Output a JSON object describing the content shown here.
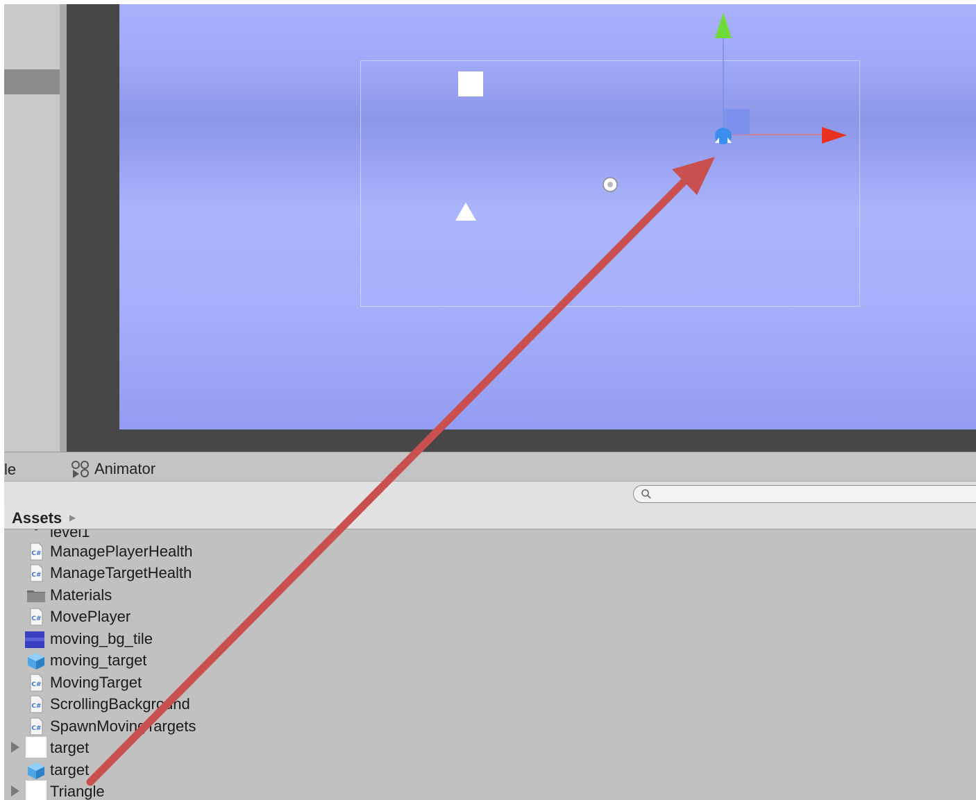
{
  "tabs": {
    "partial_label": "le",
    "animator_label": "Animator"
  },
  "search": {
    "placeholder": ""
  },
  "breadcrumb": {
    "root": "Assets"
  },
  "assets": [
    {
      "label": "level1",
      "icon": "scene-icon",
      "foldable": false
    },
    {
      "label": "ManagePlayerHealth",
      "icon": "csharp-script-icon",
      "foldable": false
    },
    {
      "label": "ManageTargetHealth",
      "icon": "csharp-script-icon",
      "foldable": false
    },
    {
      "label": "Materials",
      "icon": "folder-icon",
      "foldable": false
    },
    {
      "label": "MovePlayer",
      "icon": "csharp-script-icon",
      "foldable": false
    },
    {
      "label": "moving_bg_tile",
      "icon": "texture-icon",
      "foldable": false
    },
    {
      "label": "moving_target",
      "icon": "prefab-icon",
      "foldable": false
    },
    {
      "label": "MovingTarget",
      "icon": "csharp-script-icon",
      "foldable": false
    },
    {
      "label": "ScrollingBackground",
      "icon": "csharp-script-icon",
      "foldable": false
    },
    {
      "label": "SpawnMovingTargets",
      "icon": "csharp-script-icon",
      "foldable": false
    },
    {
      "label": "target",
      "icon": "sprite-icon",
      "foldable": true
    },
    {
      "label": "target",
      "icon": "prefab-icon",
      "foldable": false
    },
    {
      "label": "Triangle",
      "icon": "sprite-icon",
      "foldable": true
    }
  ],
  "colors": {
    "scene_bg": "#a4adf9",
    "gizmo_x": "#e8321f",
    "gizmo_y": "#6fdb38",
    "selected_handle": "#3b8ef0",
    "annotation_arrow": "#cc4a48"
  }
}
